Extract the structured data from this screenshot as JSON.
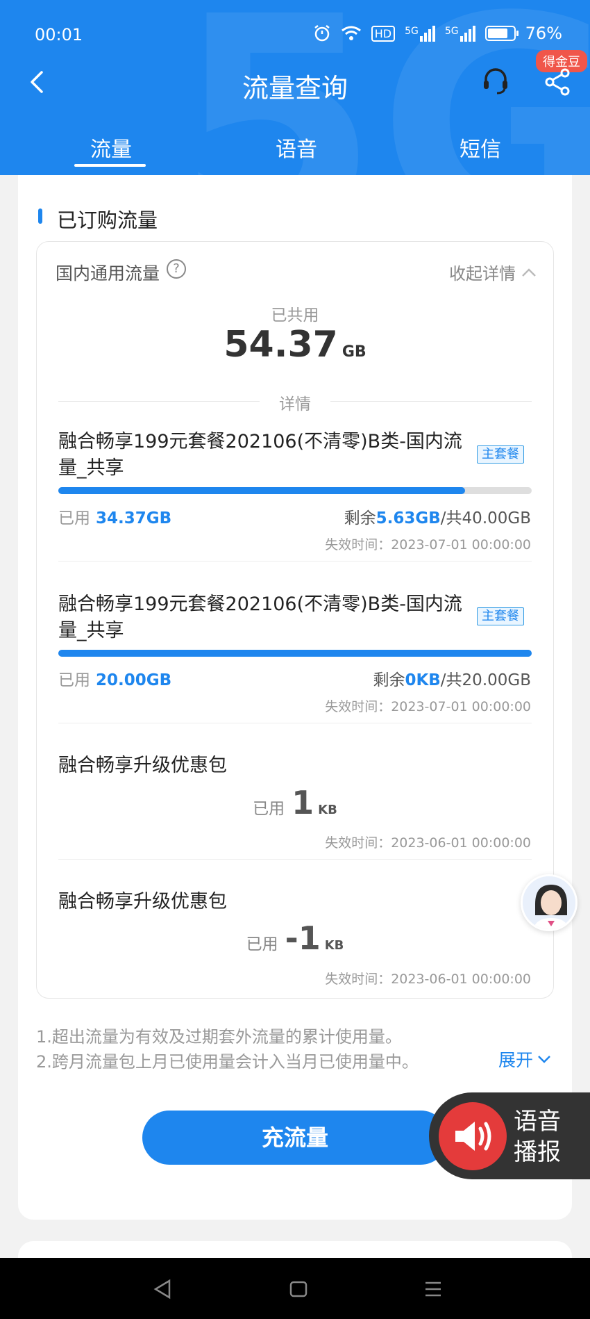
{
  "status_bar": {
    "time": "00:01",
    "battery": "76%",
    "network_labels": [
      "HD",
      "5G",
      "5G"
    ]
  },
  "nav": {
    "title": "流量查询",
    "jindou_badge": "得金豆"
  },
  "tabs": [
    {
      "label": "流量"
    },
    {
      "label": "语音"
    },
    {
      "label": "短信"
    }
  ],
  "section": {
    "title": "已订购流量",
    "category": "国内通用流量",
    "help_symbol": "?",
    "collapse_label": "收起详情",
    "shared_label": "已共用",
    "shared_value": "54.37",
    "shared_unit": "GB",
    "detail_label": "详情"
  },
  "items": [
    {
      "name": "融合畅享199元套餐202106(不清零)B类-国内流量_共享",
      "badge": "主套餐",
      "used_label": "已用",
      "used_value": "34.37GB",
      "remain_prefix": "剩余",
      "remain_value": "5.63GB",
      "total": "/共40.00GB",
      "expire": "失效时间：2023-07-01 00:00:00",
      "progress": 0.859
    },
    {
      "name": "融合畅享199元套餐202106(不清零)B类-国内流量_共享",
      "badge": "主套餐",
      "used_label": "已用",
      "used_value": "20.00GB",
      "remain_prefix": "剩余",
      "remain_value": "0KB",
      "total": "/共20.00GB",
      "expire": "失效时间：2023-07-01 00:00:00",
      "progress": 1.0
    },
    {
      "name": "融合畅享升级优惠包",
      "used_label": "已用",
      "used_value": "1",
      "used_unit": "KB",
      "expire": "失效时间：2023-06-01 00:00:00"
    },
    {
      "name": "融合畅享升级优惠包",
      "used_label": "已用",
      "used_value": "-1",
      "used_unit": "KB",
      "expire": "失效时间：2023-06-01 00:00:00"
    }
  ],
  "notes": [
    "1.超出流量为有效及过期套外流量的累计使用量。",
    "2.跨月流量包上月已使用量会计入当月已使用量中。"
  ],
  "expand_label": "展开",
  "cta_label": "充流量",
  "voice_label": [
    "语音",
    "播报"
  ],
  "colors": {
    "primary": "#1e86ee",
    "badge_red": "#f0564a",
    "voice_red": "#e43b3b"
  },
  "icons": [
    "back-icon",
    "headset-icon",
    "share-icon",
    "help-icon",
    "chevron-up-icon",
    "chevron-down-icon",
    "speaker-icon",
    "wifi-icon",
    "alarm-icon"
  ]
}
